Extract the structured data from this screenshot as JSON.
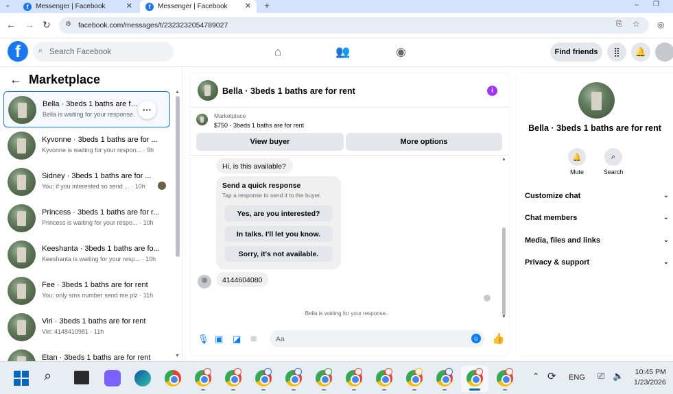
{
  "browser": {
    "tabs": [
      {
        "title": "Messenger | Facebook",
        "active": false
      },
      {
        "title": "Messenger | Facebook",
        "active": true
      }
    ],
    "new_tab": "+",
    "url": "facebook.com/messages/t/2323232054789027"
  },
  "header": {
    "logo": "f",
    "search_placeholder": "Search Facebook",
    "find_friends": "Find friends"
  },
  "left": {
    "title": "Marketplace",
    "conversations": [
      {
        "name": "Bella · 3beds 1 baths are for rent",
        "sub": "Bella is waiting for your response.",
        "time": ""
      },
      {
        "name": "Kyvonne · 3beds 1 baths are for ...",
        "sub": "Kyvonne is waiting for your respon...",
        "time": "· 9h"
      },
      {
        "name": "Sidney · 3beds 1 baths are for ...",
        "sub": "You: if you interested so send ...",
        "time": "· 10h"
      },
      {
        "name": "Princess · 3beds 1 baths are for r...",
        "sub": "Princess is waiting for your respo...",
        "time": "· 10h"
      },
      {
        "name": "Keeshanta · 3beds 1 baths are fo...",
        "sub": "Keeshanta is waiting for your resp...",
        "time": "· 10h"
      },
      {
        "name": "Fee · 3beds 1 baths are for rent",
        "sub": "You: only sms number send me plz",
        "time": "· 11h"
      },
      {
        "name": "Viri · 3beds 1 baths are for rent",
        "sub": "Viri: 4148410981",
        "time": "· 11h"
      },
      {
        "name": "Etan · 3beds 1 baths are for rent",
        "sub": "",
        "time": ""
      }
    ]
  },
  "chat": {
    "title": "Bella · 3beds 1 baths are for rent",
    "marketplace_label": "Marketplace",
    "listing": "$750 - 3beds 1 baths are for rent",
    "view_buyer": "View buyer",
    "more_options": "More options",
    "msg1": "Hi, is this available?",
    "quick_title": "Send a quick response",
    "quick_sub": "Tap a response to send it to the buyer.",
    "quick_options": [
      "Yes, are you interested?",
      "In talks. I'll let you know.",
      "Sorry, it's not available."
    ],
    "msg2": "4144604080",
    "waiting": "Bella is waiting for your response.",
    "input_placeholder": "Aa"
  },
  "right": {
    "name": "Bella · 3beds 1 baths are for rent",
    "mute": "Mute",
    "search": "Search",
    "sections": [
      "Customize chat",
      "Chat members",
      "Media, files and links",
      "Privacy & support"
    ]
  },
  "taskbar": {
    "lang": "ENG",
    "time": "10:45 PM",
    "date": "1/23/2026"
  }
}
